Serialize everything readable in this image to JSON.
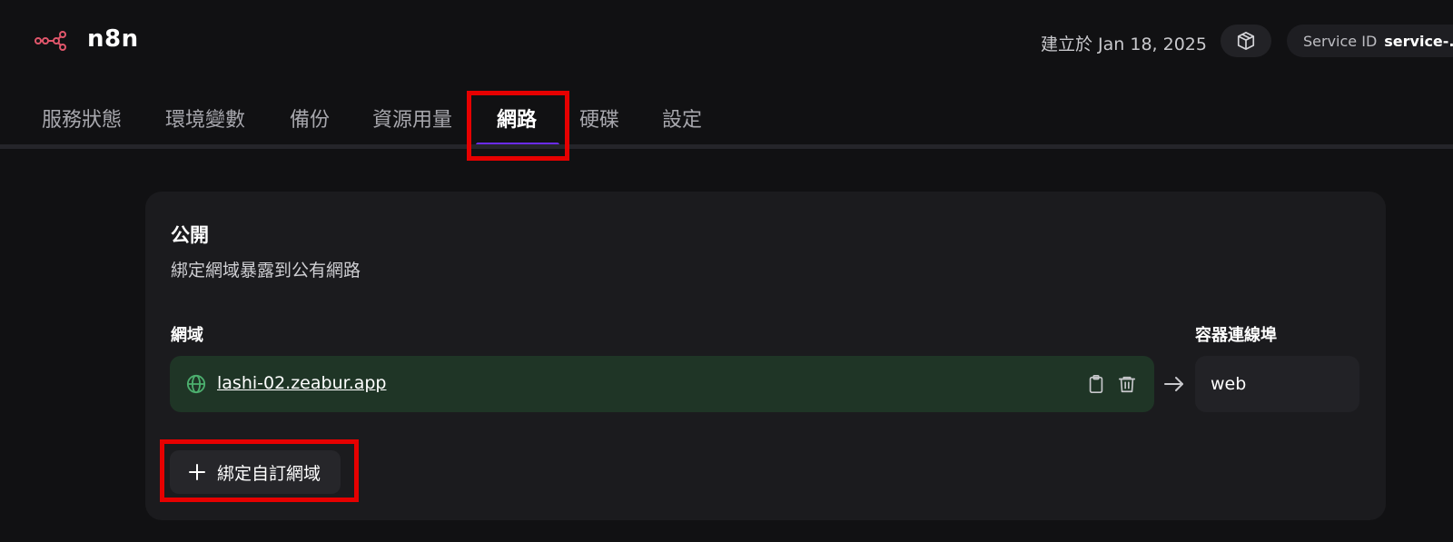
{
  "header": {
    "app_name": "n8n",
    "created_text": "建立於 Jan 18, 2025",
    "box_icon": "package-icon",
    "service_id_label": "Service ID",
    "service_id_value": "service-..."
  },
  "tabs": [
    {
      "label": "服務狀態",
      "active": false
    },
    {
      "label": "環境變數",
      "active": false
    },
    {
      "label": "備份",
      "active": false
    },
    {
      "label": "資源用量",
      "active": false
    },
    {
      "label": "網路",
      "active": true
    },
    {
      "label": "硬碟",
      "active": false
    },
    {
      "label": "設定",
      "active": false
    }
  ],
  "public_section": {
    "title": "公開",
    "subtitle": "綁定網域暴露到公有網路",
    "domain_column_label": "網域",
    "port_column_label": "容器連線埠",
    "domains": [
      {
        "domain": "lashi-02.zeabur.app",
        "port": "web"
      }
    ],
    "add_button_label": "綁定自訂網域"
  },
  "colors": {
    "accent": "#6b2bf0",
    "highlight": "#e60000",
    "domain_bg": "#1f3526",
    "globe": "#4caf6e",
    "logo": "#e0566b"
  }
}
